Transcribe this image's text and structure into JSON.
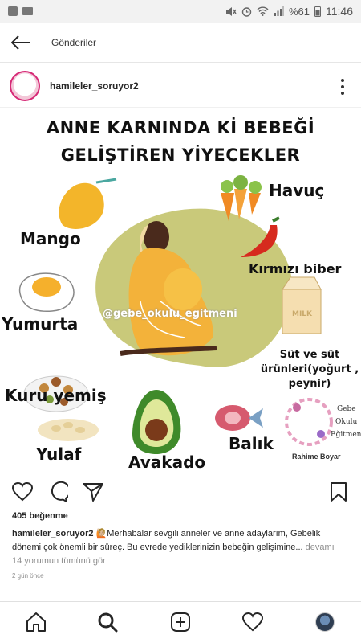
{
  "status_bar": {
    "battery": "%61",
    "time": "11:46"
  },
  "topbar": {
    "title": "Gönderiler"
  },
  "post": {
    "username": "hamileler_soruyor2",
    "image": {
      "title_line1": "ANNE KARNINDA Kİ BEBEĞİ",
      "title_line2": "GELİŞTİREN YİYECEKLER",
      "watermark": "@gebe_okulu_egitmeni",
      "foods": {
        "mango": "Mango",
        "havuc": "Havuç",
        "biber": "Kırmızı biber",
        "yumurta": "Yumurta",
        "sut_line1": "Süt ve süt",
        "sut_line2": "ürünleri(yoğurt ,",
        "sut_line3": "peynir)",
        "kuru_yemis": "Kuru yemiş",
        "yulaf": "Yulaf",
        "avakado": "Avakado",
        "balik": "Balık"
      },
      "brand_line1": "Gebe",
      "brand_line2": "Okulu",
      "brand_line3": "Eğitmeni",
      "brand_name": "Rahime Boyar",
      "milk_text": "MILK"
    },
    "likes": "405 beğenme",
    "caption_user": "hamileler_soruyor2",
    "caption_text": "🙋🏼Merhabalar sevgili anneler ve anne adaylarım, Gebelik dönemi çok önemli bir süreç. Bu evrede yediklerinizin bebeğin gelişimine...",
    "caption_more": "devamı",
    "comments": "14 yorumun tümünü gör",
    "time_ago": "2 gün önce"
  },
  "icons": [
    "arrow-left-icon",
    "more-vertical-icon",
    "heart-icon",
    "comment-icon",
    "share-icon",
    "bookmark-icon",
    "home-icon",
    "search-icon",
    "add-post-icon",
    "activity-icon"
  ],
  "colors": {
    "accent_red": "#d62a1e",
    "blob": "#c9c97a",
    "mango": "#f3b52a",
    "carrot": "#f08a24"
  }
}
